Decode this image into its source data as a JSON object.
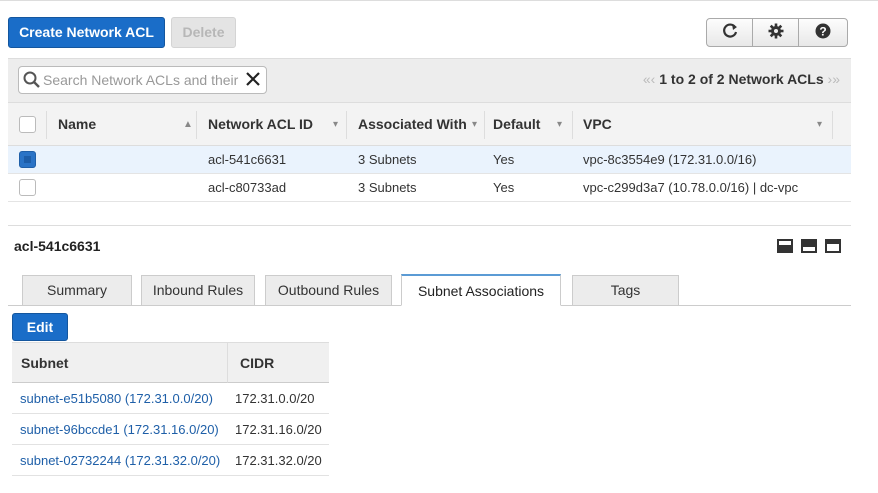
{
  "toolbar": {
    "create_label": "Create Network ACL",
    "delete_label": "Delete",
    "icons": [
      "refresh-icon",
      "gear-icon",
      "help-icon"
    ]
  },
  "search": {
    "placeholder": "Search Network ACLs and their proper",
    "value": ""
  },
  "pager": {
    "text": "1 to 2 of 2 Network ACLs"
  },
  "grid": {
    "columns": [
      "Name",
      "Network ACL ID",
      "Associated With",
      "Default",
      "VPC"
    ],
    "rows": [
      {
        "selected": true,
        "name": "",
        "acl_id": "acl-541c6631",
        "associated": "3 Subnets",
        "default": "Yes",
        "vpc": "vpc-8c3554e9 (172.31.0.0/16)"
      },
      {
        "selected": false,
        "name": "",
        "acl_id": "acl-c80733ad",
        "associated": "3 Subnets",
        "default": "Yes",
        "vpc": "vpc-c299d3a7 (10.78.0.0/16) | dc-vpc"
      }
    ]
  },
  "detail": {
    "title": "acl-541c6631",
    "tabs": [
      "Summary",
      "Inbound Rules",
      "Outbound Rules",
      "Subnet Associations",
      "Tags"
    ],
    "active_tab": "Subnet Associations",
    "edit_label": "Edit",
    "table": {
      "headers": [
        "Subnet",
        "CIDR"
      ],
      "rows": [
        {
          "subnet": "subnet-e51b5080 (172.31.0.0/20)",
          "cidr": "172.31.0.0/20"
        },
        {
          "subnet": "subnet-96bccde1 (172.31.16.0/20)",
          "cidr": "172.31.16.0/20"
        },
        {
          "subnet": "subnet-02732244 (172.31.32.0/20)",
          "cidr": "172.31.32.0/20"
        }
      ]
    }
  },
  "colors": {
    "primary": "#1a6dc8",
    "selected_row": "#eaf3fd",
    "link": "#1e5fa8"
  }
}
